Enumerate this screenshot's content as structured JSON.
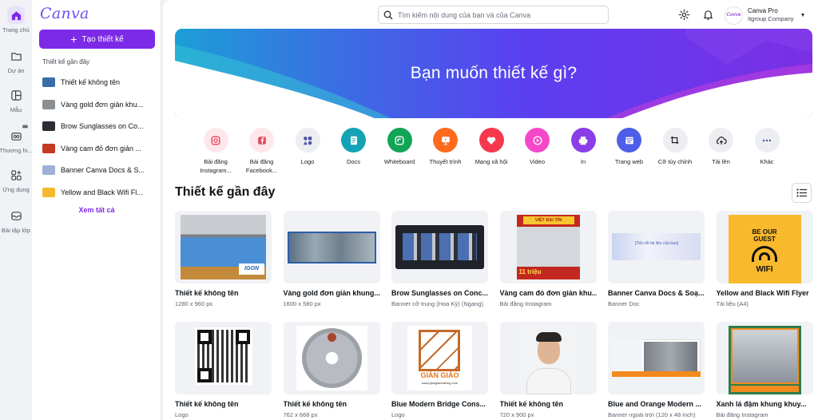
{
  "rail": [
    {
      "label": "Trang chủ",
      "icon": "home-icon"
    },
    {
      "label": "Dự án",
      "icon": "folder-icon"
    },
    {
      "label": "Mẫu",
      "icon": "template-icon"
    },
    {
      "label": "Thương hi...",
      "icon": "brand-icon"
    },
    {
      "label": "Ứng dụng",
      "icon": "apps-icon"
    },
    {
      "label": "Bài tập lớp",
      "icon": "assignment-icon"
    }
  ],
  "panel": {
    "logo": "Canva",
    "create_label": "Tạo thiết kế",
    "recent_title": "Thiết kế gần đây",
    "recent_items": [
      {
        "label": "Thiết kế không tên",
        "color": "#3b6ea8"
      },
      {
        "label": "Vàng gold đơn giản khu...",
        "color": "#8a8f94"
      },
      {
        "label": "Brow Sunglasses on Co...",
        "color": "#2a2d33"
      },
      {
        "label": "Vàng cam đỏ đơn giản ...",
        "color": "#c23a22"
      },
      {
        "label": "Banner Canva Docs & S...",
        "color": "#9fb0d8"
      },
      {
        "label": "Yellow and Black Wifi Fl...",
        "color": "#f5b82e"
      }
    ],
    "see_all": "Xem tất cả"
  },
  "header": {
    "search_placeholder": "Tìm kiếm nội dung của bạn và của Canva",
    "account_plan": "Canva Pro",
    "account_team": "Itgroup Company",
    "avatar_text": "Covve"
  },
  "hero": {
    "title": "Bạn muốn thiết kế gì?"
  },
  "categories": [
    {
      "label": "Bài đăng\nInstagram...",
      "icon": "instagram-icon",
      "bg": "#fde7ea",
      "fg": "#e8445a"
    },
    {
      "label": "Bài đăng\nFacebook...",
      "icon": "facebook-icon",
      "bg": "#fde7ea",
      "fg": "#e8445a"
    },
    {
      "label": "Logo",
      "icon": "logo-icon",
      "bg": "#eceef2",
      "fg": "#4b55a3"
    },
    {
      "label": "Docs",
      "icon": "docs-icon",
      "bg": "#13a3b5",
      "fg": "#ffffff"
    },
    {
      "label": "Whiteboard",
      "icon": "whiteboard-icon",
      "bg": "#13a557",
      "fg": "#ffffff"
    },
    {
      "label": "Thuyết trình",
      "icon": "presentation-icon",
      "bg": "#ff6a1f",
      "fg": "#ffffff"
    },
    {
      "label": "Mạng xã hội",
      "icon": "social-icon",
      "bg": "#f5384e",
      "fg": "#ffffff"
    },
    {
      "label": "Video",
      "icon": "video-icon",
      "bg": "#f548c9",
      "fg": "#ffffff"
    },
    {
      "label": "In",
      "icon": "print-icon",
      "bg": "#8b3de8",
      "fg": "#ffffff"
    },
    {
      "label": "Trang web",
      "icon": "website-icon",
      "bg": "#4d5fe8",
      "fg": "#ffffff"
    },
    {
      "label": "Cỡ tùy chỉnh",
      "icon": "custom-size-icon",
      "bg": "#eceef2",
      "fg": "#222222"
    },
    {
      "label": "Tải lên",
      "icon": "upload-icon",
      "bg": "#eceef2",
      "fg": "#222222"
    },
    {
      "label": "Khác",
      "icon": "more-icon",
      "bg": "#eceef2",
      "fg": "#4b55a3"
    }
  ],
  "recent": {
    "title": "Thiết kế gần đây",
    "items": [
      {
        "title": "Thiết kế không tên",
        "sub": "1280 x 960 px",
        "thumb": "machines"
      },
      {
        "title": "Vàng gold đơn giản khung...",
        "sub": "1600 x 580 px",
        "thumb": "factory"
      },
      {
        "title": "Brow Sunglasses on Conc...",
        "sub": "Banner cỡ trung (Hoa Kỳ) (Ngang)",
        "thumb": "tools"
      },
      {
        "title": "Vàng cam đỏ đơn giản khu...",
        "sub": "Bài đăng Instagram",
        "thumb": "promo"
      },
      {
        "title": "Banner Canva Docs & Soạ...",
        "sub": "Banner Doc",
        "thumb": "docbanner"
      },
      {
        "title": "Yellow and Black Wifi Flyer",
        "sub": "Tài liệu (A4)",
        "thumb": "wifi"
      },
      {
        "title": "Thiết kế không tên",
        "sub": "Logo",
        "thumb": "qr"
      },
      {
        "title": "Thiết kế không tên",
        "sub": "762 x 668 px",
        "thumb": "disc"
      },
      {
        "title": "Blue Modern Bridge Cons...",
        "sub": "Logo",
        "thumb": "scaffold"
      },
      {
        "title": "Thiết kế không tên",
        "sub": "720 x 900 px",
        "thumb": "portrait"
      },
      {
        "title": "Blue and Orange Modern ...",
        "sub": "Banner ngoài trời (120 x 48 inch)",
        "thumb": "outdoor"
      },
      {
        "title": "Xanh lá đậm khung khuy...",
        "sub": "Bài đăng Instagram",
        "thumb": "showroom"
      }
    ]
  },
  "wifi_flyer": {
    "line1": "BE OUR",
    "line2": "GUEST",
    "line3": "WIFI"
  },
  "promo_flyer": {
    "banner": "VIỆT ĐẠI TÍN",
    "price": "11 triệu"
  },
  "scaffold_logo": {
    "brand": "GIÀN GIÁO",
    "site": "www.giangiaohalong.com"
  },
  "doc_banner": {
    "text": "[Tiêu đề tài liệu của bạn]"
  },
  "colors": {
    "accent": "#7d2ae8",
    "brand": "#6f4ff2"
  }
}
